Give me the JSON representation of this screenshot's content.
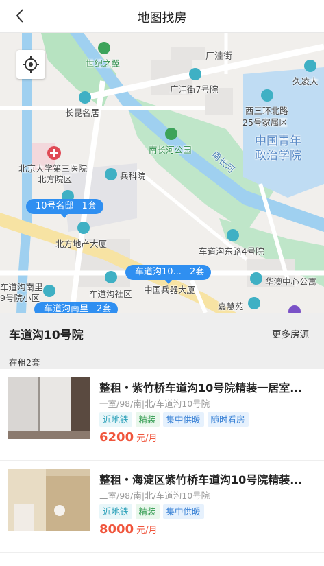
{
  "header": {
    "title": "地图找房"
  },
  "map": {
    "pois": [
      "世纪之翼",
      "广洼街7号院",
      "长昆名居",
      "西三环北路",
      "25号家属区",
      "南长河公园",
      "北京大学第三医院",
      "北方院区",
      "兵科院",
      "北方地产大厦",
      "车道沟东路4号院",
      "车道沟社区",
      "中国兵器大厦",
      "华澳中心公寓",
      "车道沟南里",
      "9号院小区",
      "嘉慧苑",
      "久凌大",
      "中国青年",
      "政治学院"
    ],
    "roads": [
      "厂洼街",
      "南长河"
    ],
    "bubbles": [
      {
        "name": "10号名邸",
        "count": "1套"
      },
      {
        "name": "车道沟10...",
        "count": "2套"
      },
      {
        "name": "车道沟南里",
        "count": "2套"
      }
    ]
  },
  "panel": {
    "community": "车道沟10号院",
    "more": "更多房源",
    "rent_count": "在租2套"
  },
  "listings": [
    {
      "title": "整租・紫竹桥车道沟10号院精装一居室...",
      "desc": "一室/98/南|北/车道沟10号院",
      "tags": [
        "近地铁",
        "精装",
        "集中供暖",
        "随时看房"
      ],
      "price": "6200",
      "unit": "元/月"
    },
    {
      "title": "整租・海淀区紫竹桥车道沟10号院精装...",
      "desc": "二室/98/南|北/车道沟10号院",
      "tags": [
        "近地铁",
        "精装",
        "集中供暖"
      ],
      "price": "8000",
      "unit": "元/月"
    }
  ],
  "colors": {
    "accent": "#2f8ff1",
    "price": "#f0553c",
    "park": "#a9dcb4",
    "river": "#9fd0f0",
    "road": "#f7e3a3"
  }
}
